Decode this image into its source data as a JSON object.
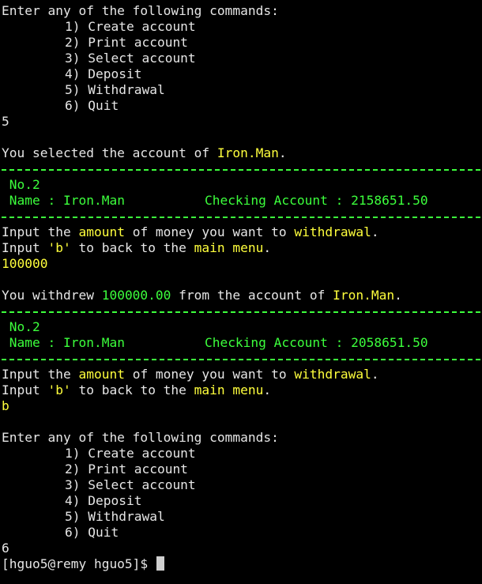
{
  "menu": {
    "prompt": "Enter any of the following commands:",
    "items": [
      "1) Create account",
      "2) Print account",
      "3) Select account",
      "4) Deposit",
      "5) Withdrawal",
      "6) Quit"
    ]
  },
  "session": {
    "input_1": "5",
    "selected_prefix": "You selected the account of ",
    "selected_name": "Iron.Man",
    "period": ".",
    "card_1": {
      "number": "No.2",
      "name_label": "Name : ",
      "name_value": "Iron.Man",
      "type_label": "Checking Account : ",
      "balance": "2158651.50"
    },
    "withdraw_prompt": {
      "part1": "Input the ",
      "amount_word": "amount",
      "part2": " of money you want to ",
      "withdrawal_word": "withdrawal",
      "part3": "."
    },
    "back_prompt": {
      "part1": "Input ",
      "b_word": "'b'",
      "part2": " to back to the ",
      "main_menu_word": "main menu",
      "part3": "."
    },
    "input_2": "100000",
    "withdrew": {
      "prefix": "You withdrew ",
      "amount": "100000.00",
      "middle": " from the account of ",
      "name": "Iron.Man",
      "suffix": "."
    },
    "card_2": {
      "number": "No.2",
      "name_label": "Name : ",
      "name_value": "Iron.Man",
      "type_label": "Checking Account : ",
      "balance": "2058651.50"
    },
    "input_3": "b",
    "input_4": "6",
    "shell_prompt": "[hguo5@remy hguo5]$ "
  },
  "colors": {
    "background": "#000000",
    "text": "#e6e6e6",
    "highlight_yellow": "#ffff3c",
    "highlight_green": "#3cff3c"
  }
}
